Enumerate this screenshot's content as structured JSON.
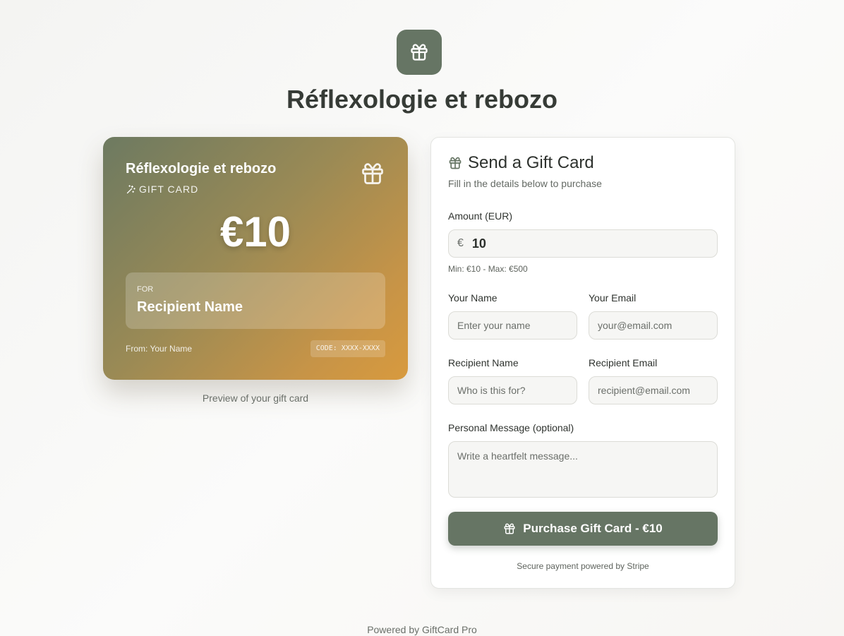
{
  "business_name": "Réflexologie et rebozo",
  "brand_color": "#667564",
  "card_preview": {
    "business_name": "Réflexologie et rebozo",
    "type_label": "GIFT CARD",
    "amount": "€10",
    "for_label": "FOR",
    "recipient_name": "Recipient Name",
    "from_text": "From: Your Name",
    "code_text": "CODE: XXXX-XXXX",
    "icons": [
      "gift-icon",
      "sparkles-icon"
    ]
  },
  "preview_caption": "Preview of your gift card",
  "form": {
    "title": "Send a Gift Card",
    "subtitle": "Fill in the details below to purchase",
    "amount_label": "Amount (EUR)",
    "currency_symbol": "€",
    "amount_value": "10",
    "amount_hint": "Min: €10 - Max: €500",
    "your_name_label": "Your Name",
    "your_name_placeholder": "Enter your name",
    "your_email_label": "Your Email",
    "your_email_placeholder": "your@email.com",
    "recipient_name_label": "Recipient Name",
    "recipient_name_placeholder": "Who is this for?",
    "recipient_email_label": "Recipient Email",
    "recipient_email_placeholder": "recipient@email.com",
    "message_label": "Personal Message (optional)",
    "message_placeholder": "Write a heartfelt message...",
    "purchase_label": "Purchase Gift Card - €10",
    "secure_note": "Secure payment powered by Stripe"
  },
  "footer": "Powered by GiftCard Pro"
}
